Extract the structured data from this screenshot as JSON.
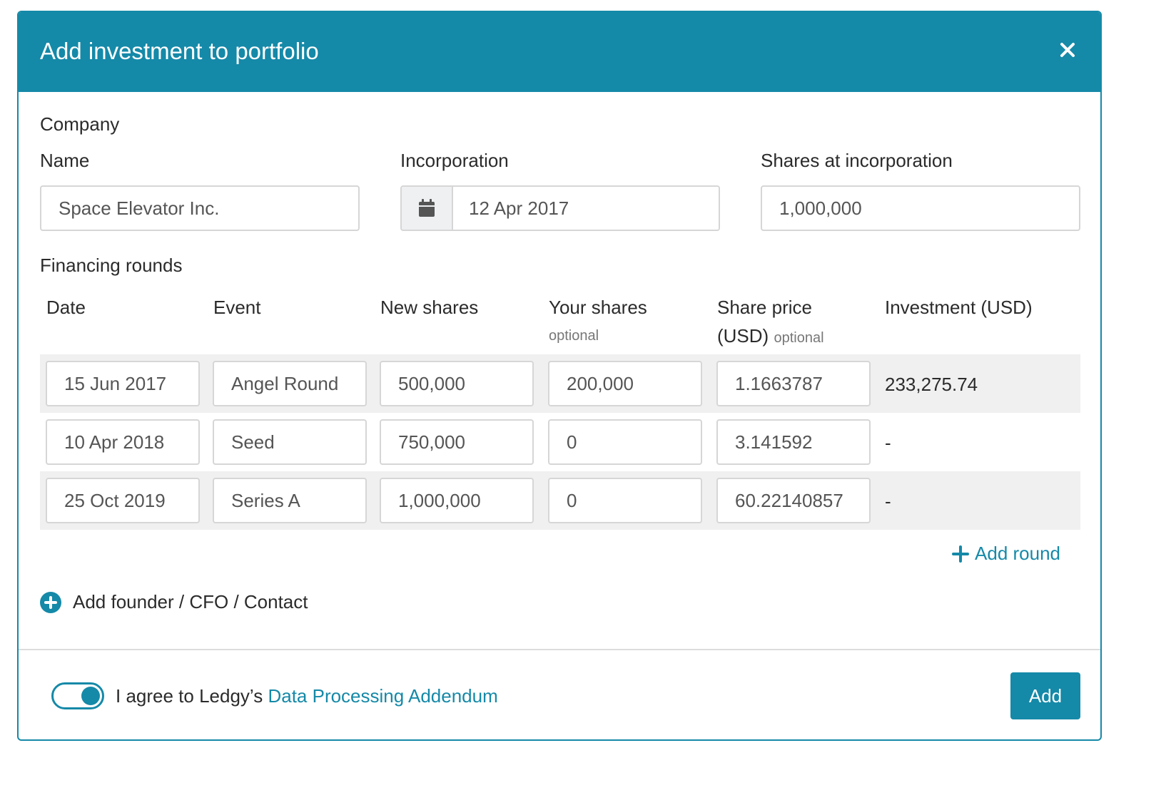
{
  "modal": {
    "title": "Add investment to portfolio",
    "close_glyph": "✕"
  },
  "company": {
    "section_title": "Company",
    "name_label": "Name",
    "name_value": "Space Elevator Inc.",
    "incorporation_label": "Incorporation",
    "incorporation_value": "12 Apr 2017",
    "shares_label": "Shares at incorporation",
    "shares_value": "1,000,000",
    "calendar_icon": "calendar-icon"
  },
  "financing": {
    "section_title": "Financing rounds",
    "headers": {
      "date": "Date",
      "event": "Event",
      "new_shares": "New shares",
      "your_shares": "Your shares",
      "your_shares_note": "optional",
      "share_price": "Share price",
      "share_price_line2": "(USD)",
      "share_price_note": "optional",
      "investment": "Investment (USD)"
    },
    "rows": [
      {
        "date": "15 Jun 2017",
        "event": "Angel Round",
        "new_shares": "500,000",
        "your_shares": "200,000",
        "share_price": "1.1663787",
        "investment": "233,275.74"
      },
      {
        "date": "10 Apr 2018",
        "event": "Seed",
        "new_shares": "750,000",
        "your_shares": "0",
        "share_price": "3.141592",
        "investment": "-"
      },
      {
        "date": "25 Oct 2019",
        "event": "Series A",
        "new_shares": "1,000,000",
        "your_shares": "0",
        "share_price": "60.22140857",
        "investment": "-"
      }
    ],
    "add_round_label": "Add round"
  },
  "contact": {
    "add_label": "Add founder / CFO / Contact"
  },
  "footer": {
    "agree_text": "I agree to Ledgy’s ",
    "agree_link": "Data Processing Addendum",
    "toggle_on": true,
    "add_button": "Add"
  },
  "colors": {
    "accent": "#1589a8",
    "row_stripe": "#f0f0f0",
    "border": "#d6d6d6"
  }
}
